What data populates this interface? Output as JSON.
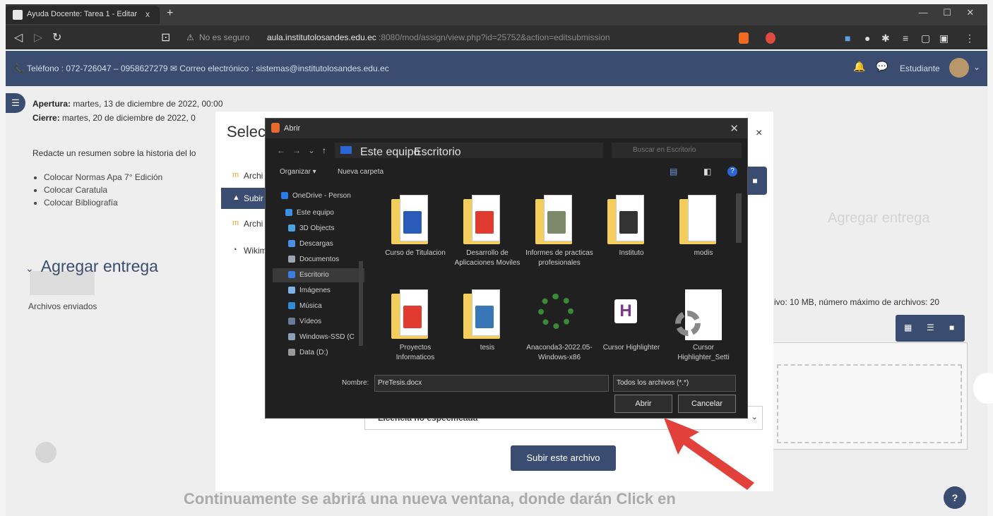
{
  "browser": {
    "tab_title": "Ayuda Docente: Tarea 1 - Editar",
    "tab_close": "x",
    "new_tab": "+",
    "not_secure": "No es seguro",
    "url_host": "aula.institutolosandes.edu.ec",
    "url_rest": ":8080/mod/assign/view.php?id=25752&action=editsubmission"
  },
  "topbar": {
    "contact": "📞 Teléfono : 072-726047 – 0958627279  ✉ Correo electrónico : sistemas@institutolosandes.edu.ec",
    "role": "Estudiante",
    "accent": "#3a4d70"
  },
  "assignment": {
    "open_label": "Apertura:",
    "open_value": "martes, 13 de diciembre de 2022, 00:00",
    "close_label": "Cierre:",
    "close_value": "martes, 20 de diciembre de 2022, 0",
    "instruction": "Redacte un resumen sobre la historia del lo",
    "bullets": [
      "Colocar Normas Apa 7° Edición",
      "Colocar Caratula",
      "Colocar Bibliografía"
    ],
    "section_title": "Agregar entrega",
    "files_label": "Archivos enviados",
    "limits": "ivo: 10 MB, número máximo de archivos: 20"
  },
  "right_blurred": {
    "heading": "Agregar entrega"
  },
  "picker": {
    "title": "Selec",
    "close": "×",
    "repos": [
      {
        "label": "Archi",
        "icon": "m"
      },
      {
        "label": "Subir",
        "icon": "▲"
      },
      {
        "label": "Archi",
        "icon": "m"
      },
      {
        "label": "Wikim",
        "icon": "◔"
      }
    ],
    "license_value": "Licencia no especificada",
    "upload_button": "Subir este archivo"
  },
  "dialog": {
    "title": "Abrir",
    "crumb": [
      "Este equipo",
      "Escritorio"
    ],
    "search_placeholder": "Buscar en Escritorio",
    "organize": "Organizar ▾",
    "new_folder": "Nueva carpeta",
    "tree": [
      {
        "label": "OneDrive - Person",
        "color": "#2c7be5"
      },
      {
        "label": "Este equipo",
        "color": "#3b8ee0"
      },
      {
        "label": "3D Objects",
        "color": "#4aa3df"
      },
      {
        "label": "Descargas",
        "color": "#4a90e2"
      },
      {
        "label": "Documentos",
        "color": "#9aa6b3"
      },
      {
        "label": "Escritorio",
        "color": "#3b7ddd"
      },
      {
        "label": "Imágenes",
        "color": "#7fb3e8"
      },
      {
        "label": "Música",
        "color": "#2f8bd8"
      },
      {
        "label": "Vídeos",
        "color": "#6b7a99"
      },
      {
        "label": "Windows-SSD (C",
        "color": "#8aa0b8"
      },
      {
        "label": "Data (D:)",
        "color": "#9a9a9a"
      }
    ],
    "files": [
      {
        "name": "Curso de Titulacion",
        "badge_color": "#2b5bb8",
        "kind": "folder"
      },
      {
        "name": "Desarrollo de Aplicaciones Moviles",
        "badge_color": "#e03b2e",
        "kind": "folder"
      },
      {
        "name": "Informes de practicas profesionales",
        "badge_color": "#7a8a6a",
        "kind": "folder"
      },
      {
        "name": "Instituto",
        "badge_color": "#333333",
        "kind": "folder"
      },
      {
        "name": "modis",
        "badge_color": "#ffffff",
        "kind": "folder"
      },
      {
        "name": "Proyectos Informaticos",
        "badge_color": "#e03b2e",
        "kind": "folder"
      },
      {
        "name": "tesis",
        "badge_color": "#3777b8",
        "kind": "folder"
      },
      {
        "name": "Anaconda3-2022.05-Windows-x86",
        "badge_color": "#3a8a3a",
        "kind": "installer"
      },
      {
        "name": "Cursor Highlighter",
        "badge_color": "#7a3a8a",
        "kind": "app"
      },
      {
        "name": "Cursor Highlighter_Setti",
        "badge_color": "#888888",
        "kind": "settings"
      }
    ],
    "name_label": "Nombre:",
    "name_value": "PreTesis.docx",
    "type_value": "Todos los archivos (*.*)",
    "open_button": "Abrir",
    "cancel_button": "Cancelar"
  },
  "bottom_caption": "Continuamente se abrirá una nueva ventana, donde darán Click en"
}
